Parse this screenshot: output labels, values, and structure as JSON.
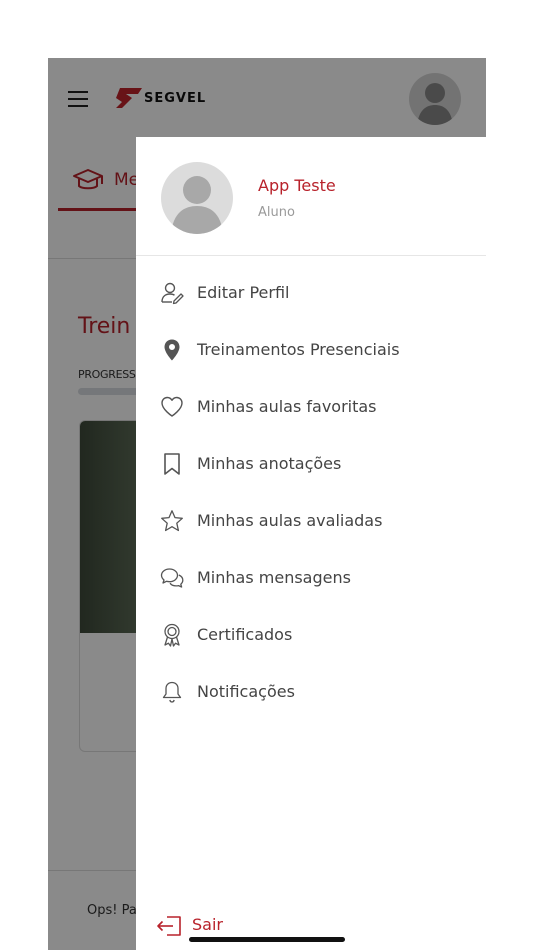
{
  "app": {
    "brand": "SEGVEL",
    "tab_label": "Me",
    "section_title": "Trein",
    "progress_label": "PROGRESS",
    "bottom_text": "Ops! Pa",
    "accent_color": "#b8222b"
  },
  "drawer": {
    "user_name": "App Teste",
    "user_role": "Aluno",
    "menu": [
      {
        "label": "Editar Perfil",
        "icon": "user-edit-icon"
      },
      {
        "label": "Treinamentos Presenciais",
        "icon": "location-pin-icon"
      },
      {
        "label": "Minhas aulas favoritas",
        "icon": "heart-icon"
      },
      {
        "label": "Minhas anotações",
        "icon": "bookmark-icon"
      },
      {
        "label": "Minhas aulas avaliadas",
        "icon": "star-icon"
      },
      {
        "label": "Minhas mensagens",
        "icon": "chat-bubbles-icon"
      },
      {
        "label": "Certificados",
        "icon": "certificate-badge-icon"
      },
      {
        "label": "Notificações",
        "icon": "bell-icon"
      }
    ],
    "logout_label": "Sair"
  }
}
